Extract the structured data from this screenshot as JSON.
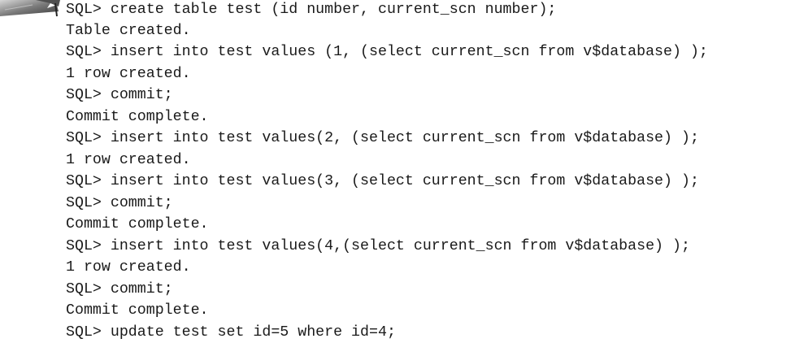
{
  "terminal": {
    "lines": [
      "SQL> create table test (id number, current_scn number);",
      "Table created.",
      "SQL> insert into test values (1, (select current_scn from v$database) );",
      "1 row created.",
      "SQL> commit;",
      "Commit complete.",
      "SQL> insert into test values(2, (select current_scn from v$database) );",
      "1 row created.",
      "SQL> insert into test values(3, (select current_scn from v$database) );",
      "SQL> commit;",
      "Commit complete.",
      "SQL> insert into test values(4,(select current_scn from v$database) );",
      "1 row created.",
      "SQL> commit;",
      "Commit complete.",
      "SQL> update test set id=5 where id=4;"
    ]
  }
}
